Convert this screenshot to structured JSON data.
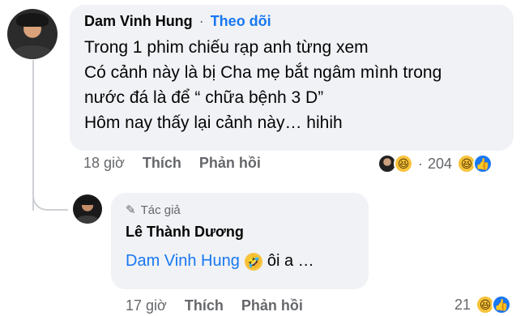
{
  "main_comment": {
    "author": "Dam Vinh Hung",
    "separator": "·",
    "follow_label": "Theo dõi",
    "lines": [
      "Trong 1 phim chiếu rạp anh từng xem",
      "Có cảnh này là bị Cha mẹ bắt ngâm mình trong",
      "nước đá là để “ chữa bệnh 3 D”",
      "Hôm nay thấy lại cảnh này… hihih"
    ],
    "time": "18 giờ",
    "like_label": "Thích",
    "reply_label": "Phản hồi",
    "reaction_separator": "·",
    "reaction_count": "204",
    "reaction_icons": [
      "avatar-reaction",
      "haha-icon",
      "haha-icon",
      "like-icon"
    ]
  },
  "reply_comment": {
    "author_tag": "Tác giả",
    "author": "Lê Thành Dương",
    "mention": "Dam Vinh Hung",
    "text": "ôi a …",
    "time": "17 giờ",
    "like_label": "Thích",
    "reply_label": "Phản hồi",
    "reaction_count": "21",
    "reaction_icons": [
      "haha-icon",
      "like-icon"
    ]
  },
  "colors": {
    "bubble": "#f0f2f5",
    "link": "#1877f2",
    "meta": "#65676b",
    "haha": "#f7c33b"
  }
}
